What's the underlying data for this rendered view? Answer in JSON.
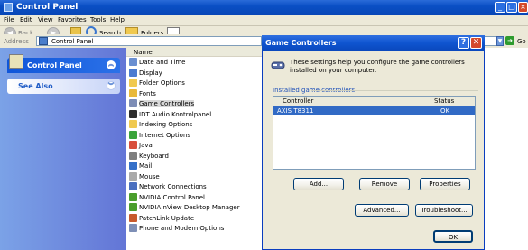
{
  "window": {
    "title": "Control Panel"
  },
  "menu": [
    "File",
    "Edit",
    "View",
    "Favorites",
    "Tools",
    "Help"
  ],
  "toolbar": {
    "back": "Back",
    "search": "Search",
    "folders": "Folders"
  },
  "address": {
    "label": "Address",
    "value": "Control Panel",
    "go": "Go"
  },
  "left_pane": {
    "control_panel": "Control Panel",
    "see_also": "See Also"
  },
  "file_list": {
    "header": "Name",
    "items": [
      {
        "label": "Date and Time",
        "icon": "clock-icon"
      },
      {
        "label": "Display",
        "icon": "display-icon"
      },
      {
        "label": "Folder Options",
        "icon": "folder-options-icon"
      },
      {
        "label": "Fonts",
        "icon": "fonts-folder-icon"
      },
      {
        "label": "Game Controllers",
        "icon": "game-controller-icon"
      },
      {
        "label": "IDT Audio Kontrolpanel",
        "icon": "audio-icon"
      },
      {
        "label": "Indexing Options",
        "icon": "indexing-icon"
      },
      {
        "label": "Internet Options",
        "icon": "internet-icon"
      },
      {
        "label": "Java",
        "icon": "java-icon"
      },
      {
        "label": "Keyboard",
        "icon": "keyboard-icon"
      },
      {
        "label": "Mail",
        "icon": "mail-icon"
      },
      {
        "label": "Mouse",
        "icon": "mouse-icon"
      },
      {
        "label": "Network Connections",
        "icon": "network-icon"
      },
      {
        "label": "NVIDIA Control Panel",
        "icon": "nvidia-icon"
      },
      {
        "label": "NVIDIA nView Desktop Manager",
        "icon": "nview-icon"
      },
      {
        "label": "PatchLink Update",
        "icon": "patchlink-icon"
      },
      {
        "label": "Phone and Modem Options",
        "icon": "phone-icon"
      }
    ]
  },
  "dialog": {
    "title": "Game Controllers",
    "help": "?",
    "description": "These settings help you configure the game controllers installed on your computer.",
    "group_label": "Installed game controllers",
    "columns": [
      "Controller",
      "Status"
    ],
    "rows": [
      {
        "controller": "AXIS T8311",
        "status": "OK"
      }
    ],
    "buttons": {
      "add": "Add...",
      "remove": "Remove",
      "properties": "Properties",
      "advanced": "Advanced...",
      "troubleshoot": "Troubleshoot...",
      "ok": "OK"
    }
  }
}
